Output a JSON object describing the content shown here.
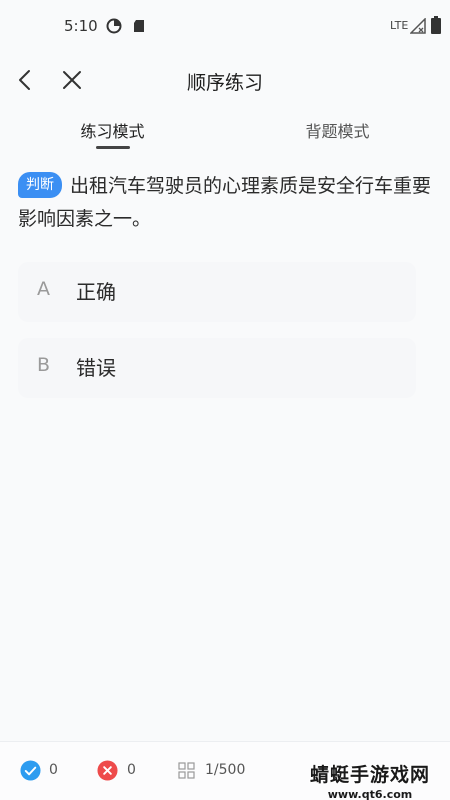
{
  "status_bar": {
    "time": "5:10",
    "network": "LTE",
    "icons": [
      "data-saver-icon",
      "sd-card-icon",
      "signal-icon",
      "battery-icon"
    ]
  },
  "topbar": {
    "title": "顺序练习",
    "icons": [
      "back-arrow-icon",
      "close-icon"
    ]
  },
  "tabs": [
    {
      "label": "练习模式",
      "active": true
    },
    {
      "label": "背题模式",
      "active": false
    }
  ],
  "question": {
    "type_badge": "判断",
    "text": "出租汽车驾驶员的心理素质是安全行车重要影响因素之一。"
  },
  "options": [
    {
      "letter": "A",
      "text": "正确"
    },
    {
      "letter": "B",
      "text": "错误"
    }
  ],
  "bottom_bar": {
    "correct_count": "0",
    "wrong_count": "0",
    "progress": "1/500",
    "colors": {
      "correct": "#2d9cf0",
      "wrong": "#ee4b4b"
    }
  },
  "watermark": {
    "title": "蜻蜓手游戏网",
    "url": "www.qt6.com"
  },
  "colors": {
    "accent": "#3b8ff3",
    "background": "#f9fafb"
  }
}
